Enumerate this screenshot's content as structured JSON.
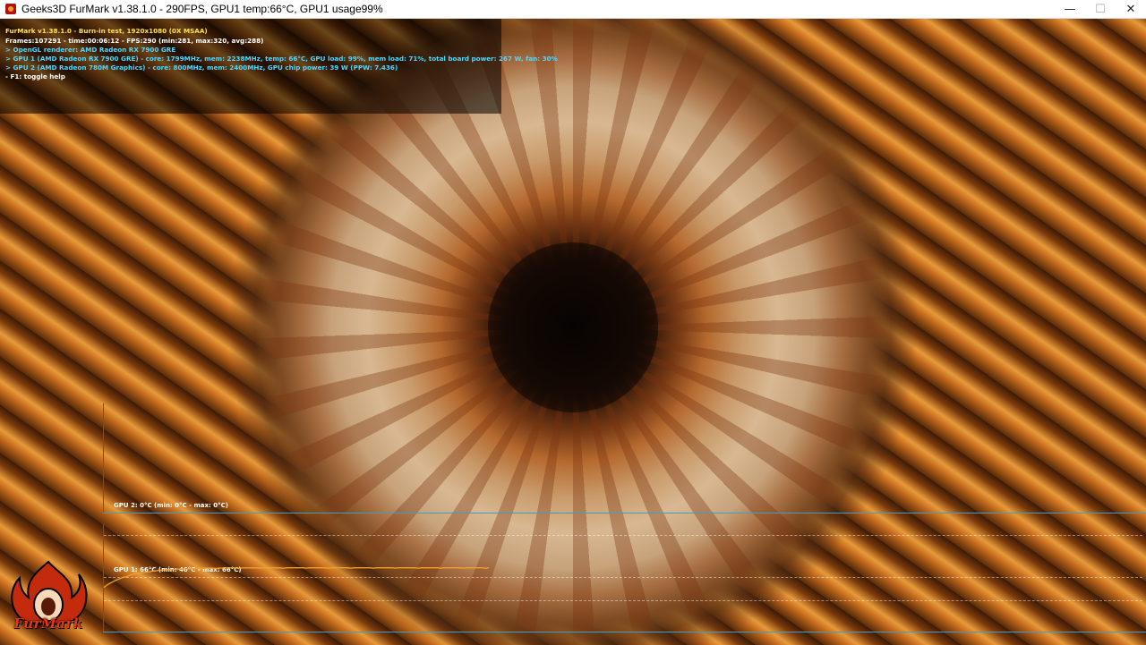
{
  "window": {
    "title": "Geeks3D FurMark v1.38.1.0 - 290FPS, GPU1 temp:66°C, GPU1 usage99%",
    "minimize_glyph": "—",
    "maximize_glyph": "☐",
    "close_glyph": "✕"
  },
  "hud": {
    "line1": "FurMark v1.38.1.0 - Burn-in test, 1920x1080 (0X MSAA)",
    "line2": "Frames:107291 - time:00:06:12 - FPS:290 (min:281, max:320, avg:288)",
    "line3": "> OpenGL renderer: AMD Radeon RX 7900 GRE",
    "line4": "> GPU 1 (AMD Radeon RX 7900 GRE) - core: 1799MHz, mem: 2238MHz, temp: 66°C, GPU load: 99%, mem load: 71%, total board power: 267 W, fan: 30%",
    "line5": "> GPU 2 (AMD Radeon 780M Graphics) - core: 800MHz, mem: 2400MHz, GPU chip power: 39 W (PPW: 7.436)",
    "line6": "- F1: toggle help"
  },
  "graphs": {
    "gpu2_label": "GPU 2: 0°C (min: 0°C - max: 0°C)",
    "gpu1_label": "GPU 1: 66°C (min: 46°C - max: 66°C)",
    "gpu1_current": 66,
    "gpu1_min": 46,
    "gpu1_max": 66,
    "gpu2_current": 0,
    "gpu1_line_color": "#f0a030"
  },
  "logo": {
    "text": "FurMark",
    "primary_color": "#e23a10"
  },
  "icons": {
    "app": "furmark-app-icon",
    "logo": "furmark-flame-logo"
  }
}
